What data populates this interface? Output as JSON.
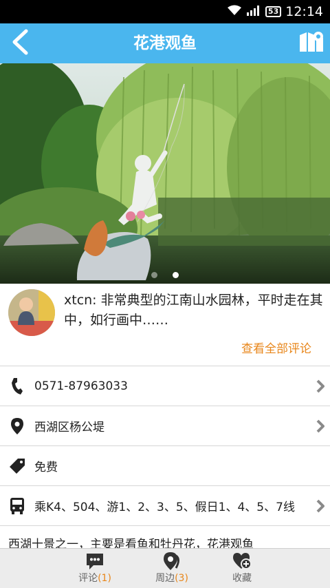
{
  "status_bar": {
    "battery": "53",
    "time": "12:14"
  },
  "header": {
    "title": "花港观鱼"
  },
  "carousel": {
    "slide_count": 2,
    "active_index": 1
  },
  "review": {
    "text": "xtcn: 非常典型的江南山水园林，平时走在其中，如行画中……",
    "all_reviews": "查看全部评论"
  },
  "info": {
    "phone": "0571-87963033",
    "address": "西湖区杨公堤",
    "price": "免费",
    "bus": "乘K4、504、游1、2、3、5、假日1、4、5、7线"
  },
  "description": "西湖十景之一，主要是看鱼和牡丹花，花港观鱼",
  "bottom_nav": {
    "comments": {
      "label": "评论",
      "count": "(1)"
    },
    "nearby": {
      "label": "周边",
      "count": "(3)"
    },
    "favorite": {
      "label": "收藏"
    }
  },
  "colors": {
    "accent": "#4ab6ee",
    "highlight": "#e8861a"
  }
}
